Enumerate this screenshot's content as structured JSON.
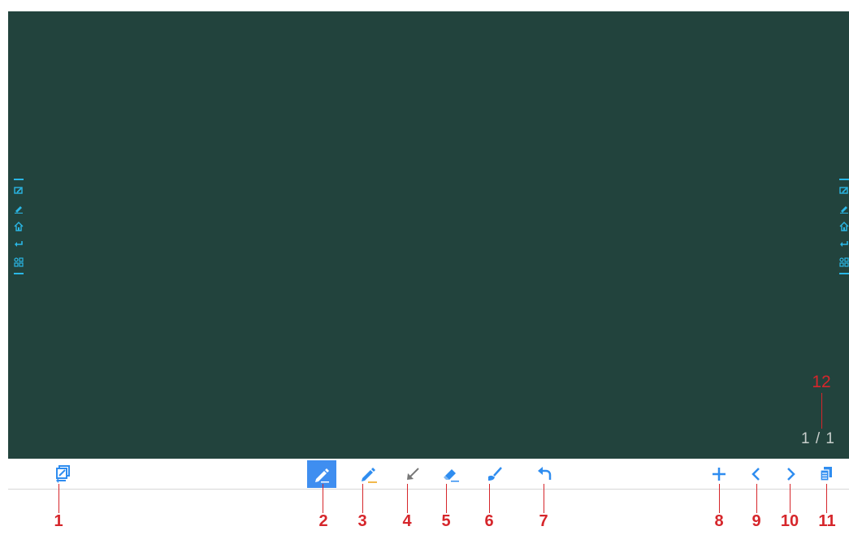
{
  "board": {
    "background": "#22433d",
    "page_indicator": "1 / 1"
  },
  "side_menu": {
    "accent": "#2ab7e6",
    "icons": [
      "whiteboard-icon",
      "pen-icon",
      "home-icon",
      "back-icon",
      "apps-icon"
    ]
  },
  "toolbar": {
    "tools": [
      {
        "name": "switch-mode",
        "icon": "whiteboard-switch-icon"
      },
      {
        "name": "pen",
        "icon": "pen-icon",
        "active": true
      },
      {
        "name": "highlighter",
        "icon": "highlighter-icon"
      },
      {
        "name": "pointer",
        "icon": "pointer-arrow-icon"
      },
      {
        "name": "eraser",
        "icon": "eraser-icon"
      },
      {
        "name": "clear",
        "icon": "brush-clear-icon"
      },
      {
        "name": "undo",
        "icon": "undo-icon"
      },
      {
        "name": "add-page",
        "icon": "plus-icon"
      },
      {
        "name": "previous-page",
        "icon": "chevron-left-icon"
      },
      {
        "name": "next-page",
        "icon": "chevron-right-icon"
      },
      {
        "name": "page-list",
        "icon": "pages-icon"
      }
    ],
    "active_color": "#3f8ef0"
  },
  "callouts": [
    "1",
    "2",
    "3",
    "4",
    "5",
    "6",
    "7",
    "8",
    "9",
    "10",
    "11",
    "12"
  ],
  "callout_color": "#d6262b"
}
